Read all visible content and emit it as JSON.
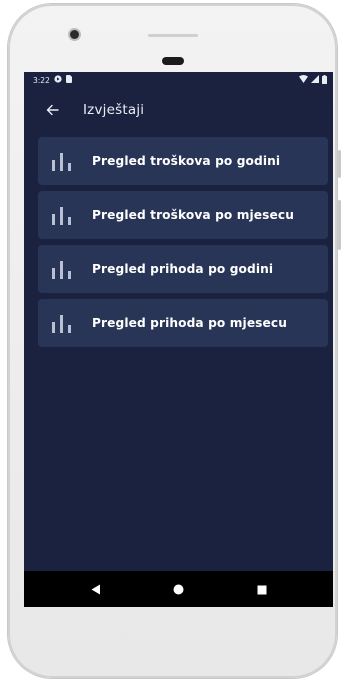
{
  "status_bar": {
    "time": "3:22",
    "icons": [
      "google-play-icon",
      "sim-card-icon",
      "wifi-icon",
      "signal-icon",
      "battery-icon"
    ]
  },
  "app_bar": {
    "back_icon": "arrow-left-icon",
    "title": "Izvještaji"
  },
  "reports": [
    {
      "label": "Pregled troškova po godini",
      "icon": "bar-chart-icon"
    },
    {
      "label": "Pregled troškova po mjesecu",
      "icon": "bar-chart-icon"
    },
    {
      "label": "Pregled prihoda po godini",
      "icon": "bar-chart-icon"
    },
    {
      "label": "Pregled prihoda po mjesecu",
      "icon": "bar-chart-icon"
    }
  ],
  "nav_bar": {
    "buttons": [
      "back-triangle-icon",
      "home-circle-icon",
      "recents-square-icon"
    ]
  },
  "colors": {
    "background": "#1a2240",
    "card": "#293557",
    "text": "#ffffff"
  }
}
